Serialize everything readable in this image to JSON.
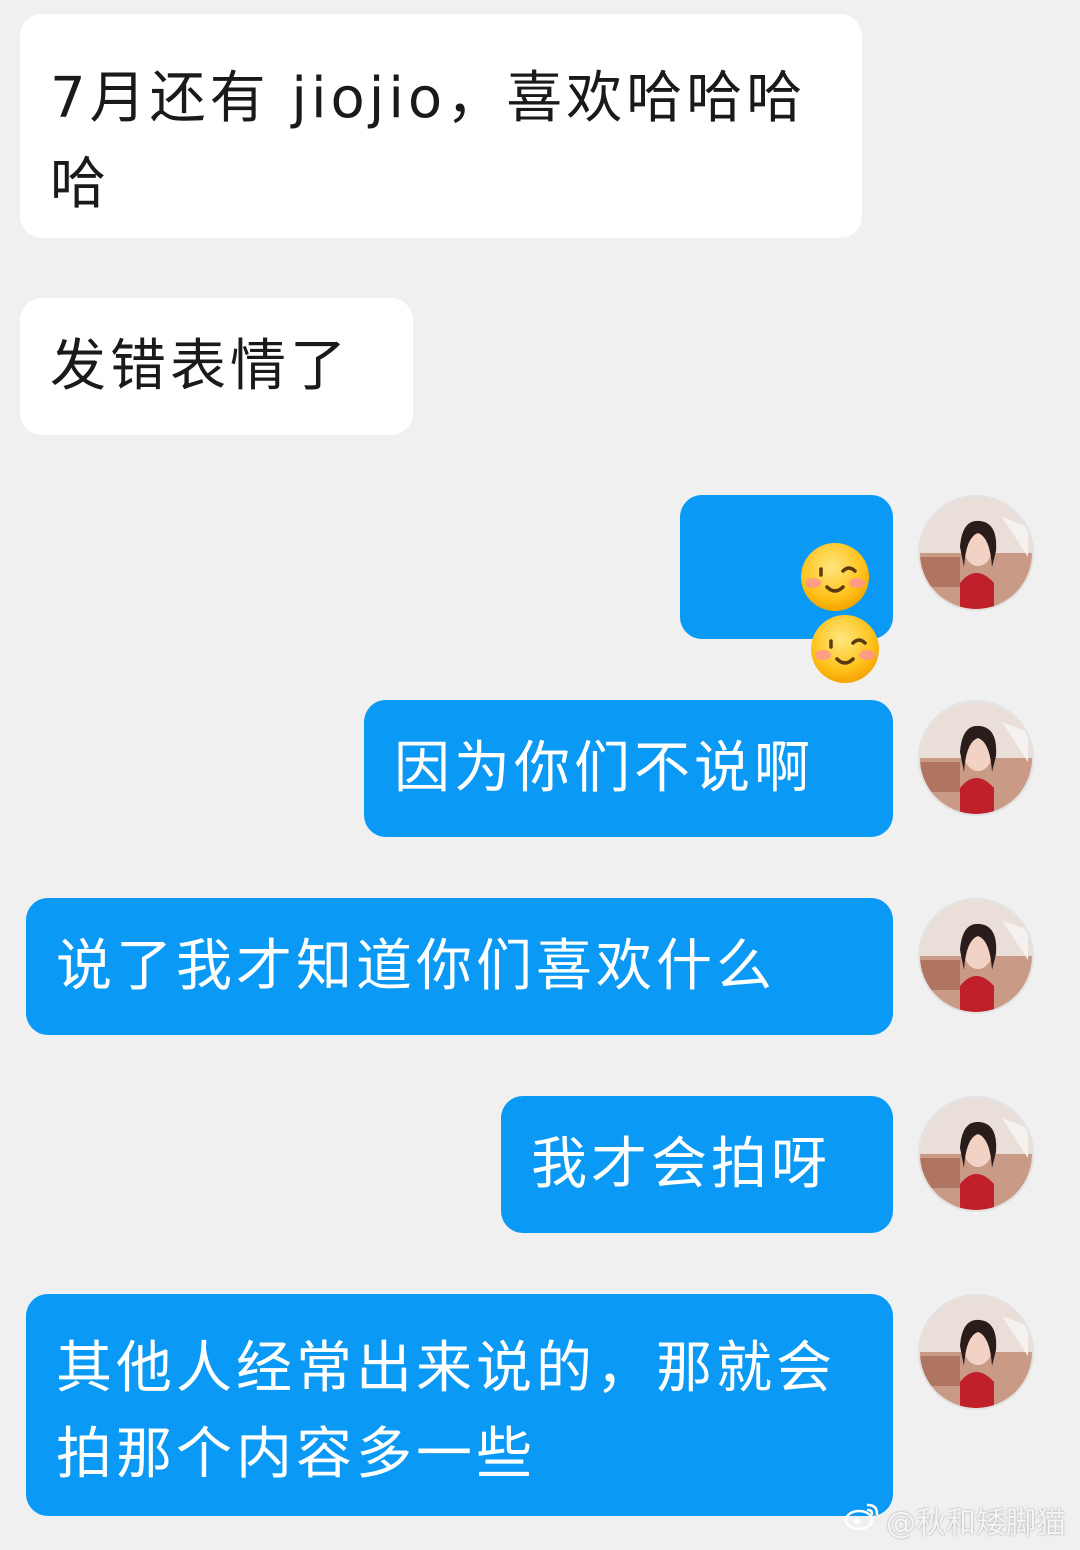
{
  "messages": [
    {
      "from": "other",
      "text": "7月还有 jiojio，喜欢哈哈哈哈"
    },
    {
      "from": "other",
      "text": "发错表情了"
    },
    {
      "from": "me",
      "type": "emoji",
      "emojis": [
        "smiley-blush-wink",
        "smiley-blush-wink"
      ]
    },
    {
      "from": "me",
      "text": "因为你们不说啊"
    },
    {
      "from": "me",
      "text": "说了我才知道你们喜欢什么"
    },
    {
      "from": "me",
      "text": "我才会拍呀"
    },
    {
      "from": "me",
      "text": "其他人经常出来说的，那就会拍那个内容多一些"
    }
  ],
  "watermark": {
    "text": "@秋和矮脚猫",
    "icon": "weibo-logo"
  },
  "colors": {
    "background": "#f0f0f0",
    "incoming_bubble": "#ffffff",
    "outgoing_bubble": "#0a99f4",
    "outgoing_text": "#ffffff"
  }
}
